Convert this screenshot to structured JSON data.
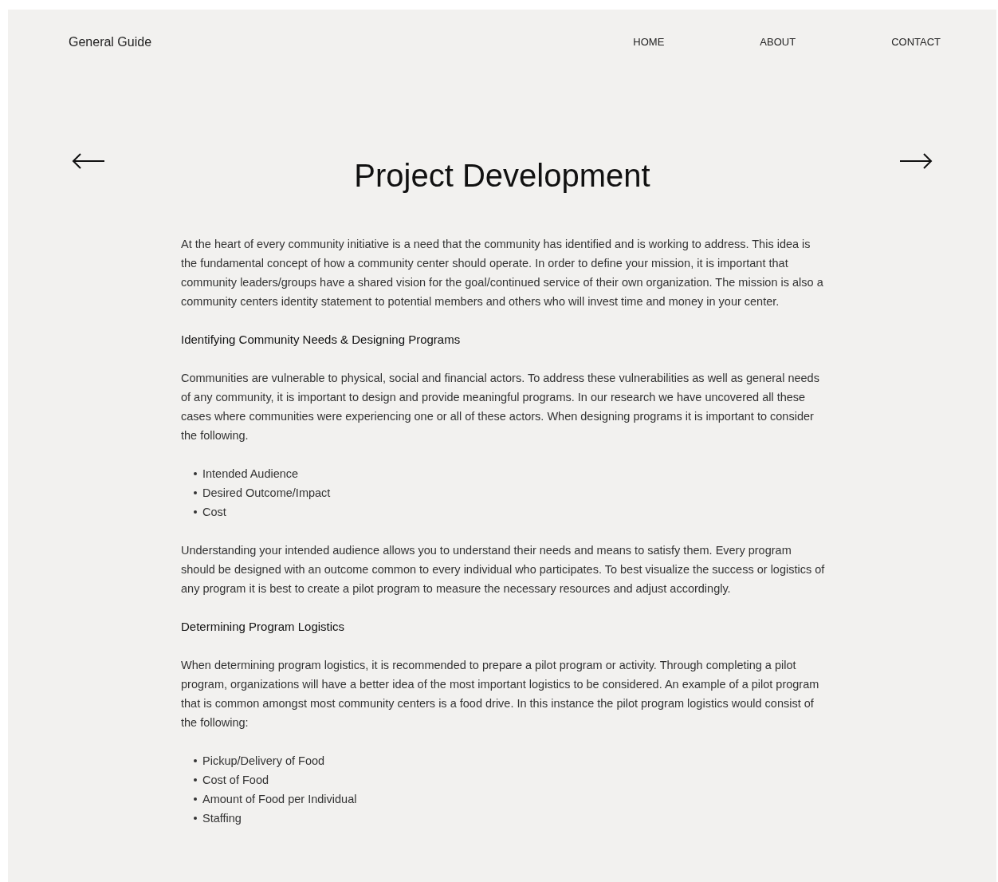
{
  "nav": {
    "brand": "General Guide",
    "links": [
      "HOME",
      "ABOUT",
      "CONTACT"
    ]
  },
  "title": "Project Development",
  "content": [
    {
      "kind": "paragraph",
      "text": "At the heart of every community initiative is a need that the community has identified and is working to address. This idea is the fundamental concept of how a community center should operate. In order to define your mission, it is important that community leaders/groups have a shared vision for the goal/continued service of their own organization. The mission is also a community centers identity statement to potential members and others who will invest time and money in your center."
    },
    {
      "kind": "heading",
      "text": "Identifying Community Needs & Designing Programs"
    },
    {
      "kind": "paragraph",
      "text": "Communities are vulnerable to physical, social and financial actors. To address these vulnerabilities as well as general needs of any community, it is important to design and provide meaningful programs. In our research we have uncovered all these cases where communities were experiencing one or all of these actors. When designing programs it is important to consider the following."
    },
    {
      "kind": "list",
      "items": [
        "Intended Audience",
        "Desired Outcome/Impact",
        "Cost"
      ]
    },
    {
      "kind": "paragraph",
      "text": "Understanding your intended audience allows you to understand their needs and means to satisfy them. Every program should be designed with an outcome common to every individual who participates. To best visualize the success or logistics of any program it is best to create a pilot program to measure the necessary resources and adjust accordingly."
    },
    {
      "kind": "heading",
      "text": "Determining Program Logistics"
    },
    {
      "kind": "paragraph",
      "text": "When determining program logistics, it is recommended to prepare a pilot program or activity. Through completing a pilot program, organizations will have a better idea of the most important logistics to be considered. An example of a pilot program that is common amongst most community centers is a food drive. In this instance the pilot program logistics would consist of the following:"
    },
    {
      "kind": "list",
      "items": [
        "Pickup/Delivery of Food",
        "Cost of Food",
        "Amount of Food per Individual",
        "Staffing"
      ]
    }
  ]
}
